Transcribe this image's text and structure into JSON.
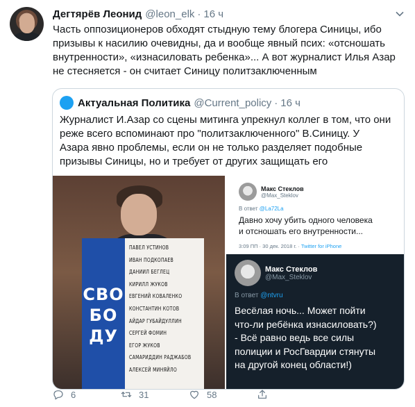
{
  "tweet": {
    "author_name": "Дегтярёв Леонид",
    "author_handle": "@leon_elk",
    "separator": "·",
    "time": "16 ч",
    "text_lines": [
      "Часть оппозиционеров обходят стыдную тему блогера Синицы, ибо",
      "призывы к насилию очевидны, да и вообще явный псих: «отсношать",
      "внутренности», «изнасиловать ребенка»... А вот журналист Илья Азар",
      "не стесняется - он считает Синицу политзаключенным"
    ]
  },
  "quoted": {
    "author_name": "Актуальная Политика",
    "author_handle": "@Current_policy",
    "separator": "·",
    "time": "16 ч",
    "text_lines": [
      "Журналист И.Азар со сцены митинга упрекнул коллег в том, что они",
      "реже всего вспоминают про \"политзаключенного\" В.Синицу. У",
      "Азара явно проблемы, если он не только разделяет подобные",
      "призывы Синицы, но и требует от других защищать его"
    ],
    "photo": {
      "sign_letters": [
        "СВО",
        "БО",
        "ДУ"
      ],
      "sign_names": [
        "ПАВЕЛ УСТИНОВ",
        "ИВАН ПОДКОПАЕВ",
        "ДАНИИЛ БЕГЛЕЦ",
        "КИРИЛЛ ЖУКОВ",
        "ЕВГЕНИЙ КОВАЛЕНКО",
        "КОНСТАНТИН КОТОВ",
        "АЙДАР ГУБАЙДУЛЛИН",
        "СЕРГЕЙ ФОМИН",
        "ЕГОР ЖУКОВ",
        "САМАРИДДИН РАДЖАБОВ",
        "АЛЕКСЕЙ МИНЯЙЛО"
      ]
    },
    "screenshot_light": {
      "name": "Макс Стеклов",
      "handle": "@Max_Steklov",
      "reply_prefix": "В ответ",
      "reply_to": "@La72La",
      "body_lines": [
        "Давно хочу убить одного человека",
        "и отсношать его внутренности..."
      ],
      "footer_time": "3:09 ПП · 30 дек. 2018 г. ·",
      "footer_source": "Twitter for iPhone"
    },
    "screenshot_dark": {
      "name": "Макс Стеклов",
      "handle": "@Max_Steklov",
      "reply_prefix": "В ответ",
      "reply_to": "@ntvru",
      "body_lines": [
        "Весёлая ночь... Может пойти",
        "что-ли ребёнка изнасиловать?)",
        "- Всё равно ведь все силы",
        "полиции и РосГвардии стянуты",
        "на другой конец области!)"
      ]
    }
  },
  "actions": {
    "reply_count": "6",
    "retweet_count": "31",
    "like_count": "58"
  },
  "colors": {
    "text": "#14171a",
    "secondary": "#657786",
    "accent": "#1da1f2",
    "border": "#ccd6dd",
    "dark_card": "#15202b",
    "sign_blue": "#1f4fa8"
  }
}
